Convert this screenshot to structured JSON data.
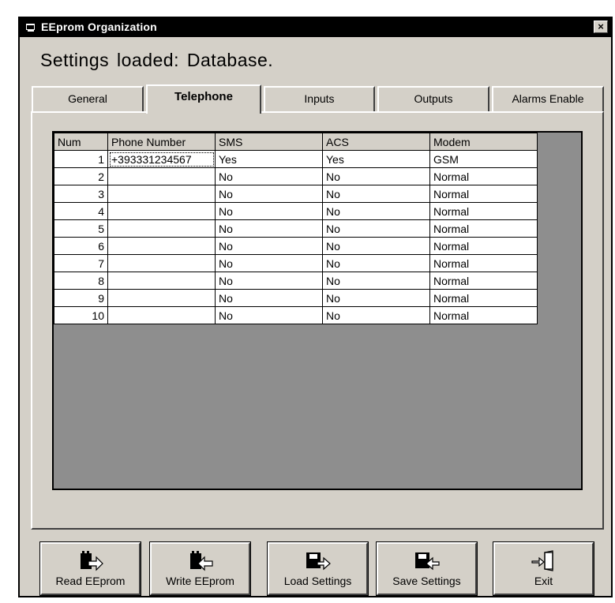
{
  "window": {
    "title": "EEprom Organization",
    "close_glyph": "×",
    "icon": "app-window-icon"
  },
  "status": {
    "label": "Settings loaded:  Database."
  },
  "tabs": [
    {
      "label": "General"
    },
    {
      "label": "Telephone",
      "active": true
    },
    {
      "label": "Inputs"
    },
    {
      "label": "Outputs"
    },
    {
      "label": "Alarms Enable"
    }
  ],
  "grid": {
    "columns": [
      "Num",
      "Phone Number",
      "SMS",
      "ACS",
      "Modem"
    ],
    "rows": [
      [
        "1",
        "+393331234567",
        "Yes",
        "Yes",
        "GSM"
      ],
      [
        "2",
        "",
        "No",
        "No",
        "Normal"
      ],
      [
        "3",
        "",
        "No",
        "No",
        "Normal"
      ],
      [
        "4",
        "",
        "No",
        "No",
        "Normal"
      ],
      [
        "5",
        "",
        "No",
        "No",
        "Normal"
      ],
      [
        "6",
        "",
        "No",
        "No",
        "Normal"
      ],
      [
        "7",
        "",
        "No",
        "No",
        "Normal"
      ],
      [
        "8",
        "",
        "No",
        "No",
        "Normal"
      ],
      [
        "9",
        "",
        "No",
        "No",
        "Normal"
      ],
      [
        "10",
        "",
        "No",
        "No",
        "Normal"
      ]
    ]
  },
  "buttons": {
    "read": {
      "label": "Read EEprom",
      "icon": "chip-read-icon"
    },
    "write": {
      "label": "Write EEprom",
      "icon": "chip-write-icon"
    },
    "load": {
      "label": "Load Settings",
      "icon": "load-settings-icon"
    },
    "save": {
      "label": "Save Settings",
      "icon": "save-settings-icon"
    },
    "exit": {
      "label": "Exit",
      "icon": "exit-door-icon"
    }
  }
}
